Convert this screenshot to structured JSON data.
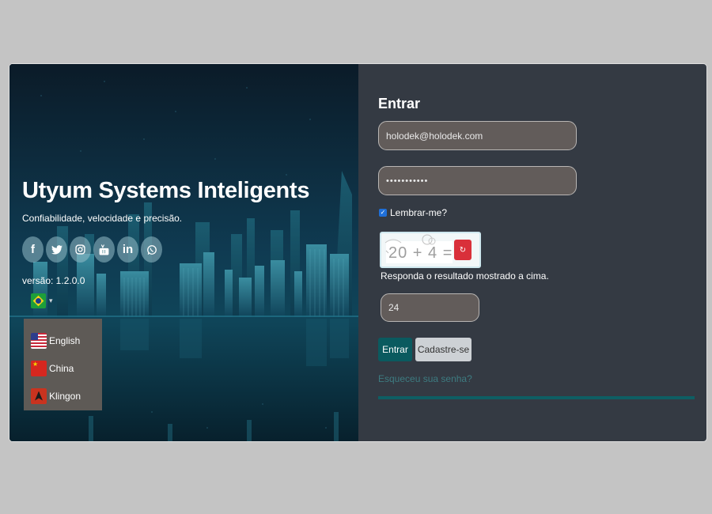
{
  "brand": {
    "title": "Utyum Systems Inteligents",
    "subtitle": "Confiabilidade, velocidade e precisão.",
    "version": "versão: 1.2.0.0"
  },
  "social": [
    {
      "icon": "facebook-icon",
      "glyph": "f"
    },
    {
      "icon": "twitter-icon",
      "glyph": "🐦"
    },
    {
      "icon": "instagram-icon",
      "glyph": "◎"
    },
    {
      "icon": "youtube-icon",
      "glyph": "▶"
    },
    {
      "icon": "linkedin-icon",
      "glyph": "in"
    },
    {
      "icon": "whatsapp-icon",
      "glyph": "✆"
    }
  ],
  "language": {
    "current": "brazil-flag",
    "options": [
      {
        "label": "English",
        "flag": "us-flag"
      },
      {
        "label": "China",
        "flag": "china-flag"
      },
      {
        "label": "Klingon",
        "flag": "klingon-flag"
      }
    ]
  },
  "login": {
    "title": "Entrar",
    "email_value": "holodek@holodek.com",
    "password_value": "•••••••••••",
    "remember_label": "Lembrar-me?",
    "remember_checked": true,
    "captcha_expression": "20 + 4 =",
    "captcha_refresh_glyph": "↻",
    "captcha_help": "Responda o resultado mostrado a cima.",
    "answer_value": "24",
    "enter_button": "Entrar",
    "register_button": "Cadastre-se",
    "forgot_link": "Esqueceu sua senha?",
    "progress": 1.0
  },
  "colors": {
    "page_bg": "#c4c4c4",
    "panel_bg": "#343a43",
    "accent": "#0a5a5f",
    "danger": "#d9303a"
  }
}
